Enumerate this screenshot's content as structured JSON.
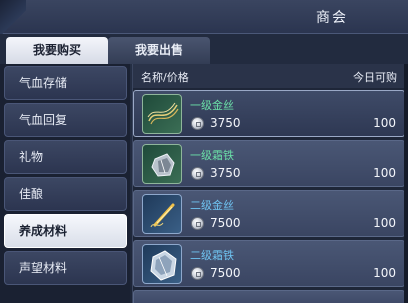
{
  "window": {
    "title": "商会"
  },
  "tabs": [
    {
      "label": "我要购买",
      "active": true
    },
    {
      "label": "我要出售",
      "active": false
    }
  ],
  "sidebar": {
    "items": [
      {
        "label": "气血存储",
        "active": false
      },
      {
        "label": "气血回复",
        "active": false
      },
      {
        "label": "礼物",
        "active": false
      },
      {
        "label": "佳酿",
        "active": false
      },
      {
        "label": "养成材料",
        "active": true
      },
      {
        "label": "声望材料",
        "active": false
      }
    ]
  },
  "list": {
    "header_left": "名称/价格",
    "header_right": "今日可购",
    "items": [
      {
        "name": "一级金丝",
        "price": "3750",
        "qty": "100",
        "icon": "gold-thread-icon",
        "color": "#6be0a8"
      },
      {
        "name": "一级霜铁",
        "price": "3750",
        "qty": "100",
        "icon": "frost-iron-icon",
        "color": "#6be0a8"
      },
      {
        "name": "二级金丝",
        "price": "7500",
        "qty": "100",
        "icon": "gold-thread-icon",
        "color": "#6fc4f2"
      },
      {
        "name": "二级霜铁",
        "price": "7500",
        "qty": "100",
        "icon": "frost-iron-icon",
        "color": "#6fc4f2"
      }
    ]
  }
}
